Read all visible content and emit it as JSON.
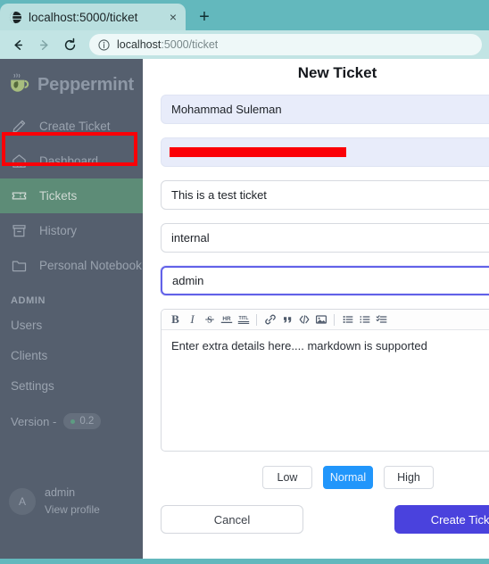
{
  "browser": {
    "tab": {
      "title": "localhost:5000/ticket",
      "favicon_name": "globe-icon",
      "close_label": "×"
    },
    "newtab_label": "+",
    "nav": {
      "back_label": "←",
      "forward_label": "→",
      "reload_label": "⟳"
    },
    "urlbar": {
      "info_icon": "info-circle-icon",
      "host": "localhost",
      "path": ":5000/ticket"
    },
    "colors": {
      "tabstrip": "#63b8bd",
      "active_tab": "#b9dfdf",
      "toolbar": "#c2e4e4",
      "urlbar": "#eef8f8"
    }
  },
  "sidebar": {
    "brand": "Peppermint",
    "brand_logo_name": "peppermint-teacup-logo",
    "items": [
      {
        "label": "Create Ticket",
        "icon": "pencil-icon",
        "active": false
      },
      {
        "label": "Dashboard",
        "icon": "home-icon",
        "active": false
      },
      {
        "label": "Tickets",
        "icon": "ticket-icon",
        "active": true
      },
      {
        "label": "History",
        "icon": "archive-icon",
        "active": false
      },
      {
        "label": "Personal Notebook",
        "icon": "folder-icon",
        "active": false
      }
    ],
    "admin_section_label": "ADMIN",
    "admin_items": [
      {
        "label": "Users"
      },
      {
        "label": "Clients"
      },
      {
        "label": "Settings"
      }
    ],
    "version": {
      "label": "Version -",
      "value": "0.2",
      "dot_color": "#5d9c82"
    },
    "profile": {
      "initial": "A",
      "name": "admin",
      "link": "View profile"
    },
    "colors": {
      "background": "#555f6e",
      "active_item": "#5d8c77",
      "text": "#9aa3af"
    }
  },
  "annotation": {
    "target": "Create Ticket",
    "color": "#fb0007",
    "redaction_color": "#fb0007"
  },
  "main": {
    "title": "New Ticket",
    "fields": [
      {
        "name": "client-name",
        "value": "Mohammad Suleman",
        "readonly": true,
        "redacted": false
      },
      {
        "name": "client-email",
        "value": "",
        "readonly": true,
        "redacted": true
      },
      {
        "name": "ticket-title",
        "value": "This is a test ticket",
        "readonly": false,
        "redacted": false
      },
      {
        "name": "ticket-type",
        "value": "internal",
        "readonly": false,
        "redacted": false
      },
      {
        "name": "assignee",
        "value": "admin",
        "readonly": false,
        "redacted": false,
        "focused": true
      }
    ],
    "editor": {
      "placeholder": "Enter extra details here.... markdown is supported",
      "toolbar": [
        {
          "icon": "bold-icon",
          "label": "B"
        },
        {
          "icon": "italic-icon",
          "label": "I"
        },
        {
          "icon": "strikethrough-icon",
          "label": "S"
        },
        {
          "icon": "horizontal-rule-icon",
          "label": "HR"
        },
        {
          "icon": "title-icon",
          "label": "TITLE"
        },
        {
          "icon": "link-icon",
          "label": "🔗"
        },
        {
          "icon": "quote-icon",
          "label": "”"
        },
        {
          "icon": "code-icon",
          "label": "</>"
        },
        {
          "icon": "image-icon",
          "label": "▣"
        },
        {
          "icon": "bullet-list-icon",
          "label": "☰"
        },
        {
          "icon": "ordered-list-icon",
          "label": "≡"
        },
        {
          "icon": "checklist-icon",
          "label": "✓≡"
        }
      ]
    },
    "priority": {
      "options": [
        "Low",
        "Normal",
        "High"
      ],
      "selected": "Normal",
      "selected_color": "#2196fb"
    },
    "footer": {
      "cancel_label": "Cancel",
      "submit_label": "Create Ticket",
      "submit_color": "#4a42dd"
    }
  }
}
